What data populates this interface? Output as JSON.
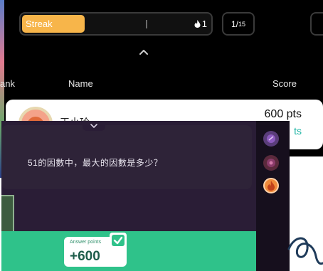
{
  "board": {
    "streak_label": "Streak",
    "streak_count": "1",
    "streak_progress": 0.33,
    "counter_current": "1/",
    "counter_total": "15",
    "columns": {
      "rank": "ank",
      "name": "Name",
      "score": "Score"
    },
    "player": {
      "name": "王小玲",
      "score": "600 pts",
      "points_extra": "ts"
    }
  },
  "question": {
    "text": "51的因數中，最大的因數是多少？"
  },
  "answer": {
    "label": "Answer points",
    "value": "+600"
  },
  "colors": {
    "streak_fill": "#f7b54a",
    "answer_bar": "#2fc28a",
    "points_teal": "#1db4a4",
    "question_bg": "#2a1d36"
  },
  "icons": {
    "streak": "flame-icon",
    "expand": "chevron-up-icon",
    "collapse": "chevron-down-icon",
    "check": "check-icon",
    "prev": "triangle-left-icon",
    "next": "triangle-right-icon"
  }
}
